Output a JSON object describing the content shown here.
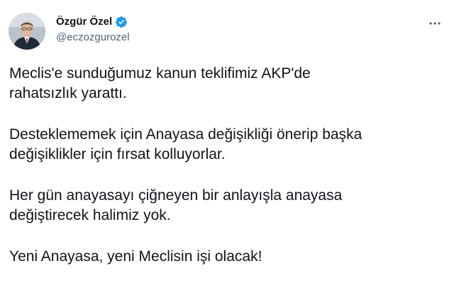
{
  "author": {
    "display_name": "Özgür Özel",
    "handle": "@eczozgurozel",
    "verified": true
  },
  "icons": {
    "verified": "verified-badge-icon",
    "more": "more-options-icon",
    "avatar": "profile-photo"
  },
  "colors": {
    "verified_blue": "#1d9bf0",
    "text_primary": "#0f1419",
    "text_secondary": "#536471"
  },
  "tweet": {
    "paragraphs": [
      "Meclis'e sunduğumuz kanun teklifimiz AKP'de\nrahatsızlık yarattı.",
      "Desteklememek için Anayasa değişikliği önerip başka\ndeğişiklikler için fırsat kolluyorlar.",
      "Her gün anayasayı çiğneyen bir anlayışla anayasa\ndeğiştirecek halimiz yok.",
      "Yeni Anayasa, yeni Meclisin işi olacak!"
    ]
  }
}
